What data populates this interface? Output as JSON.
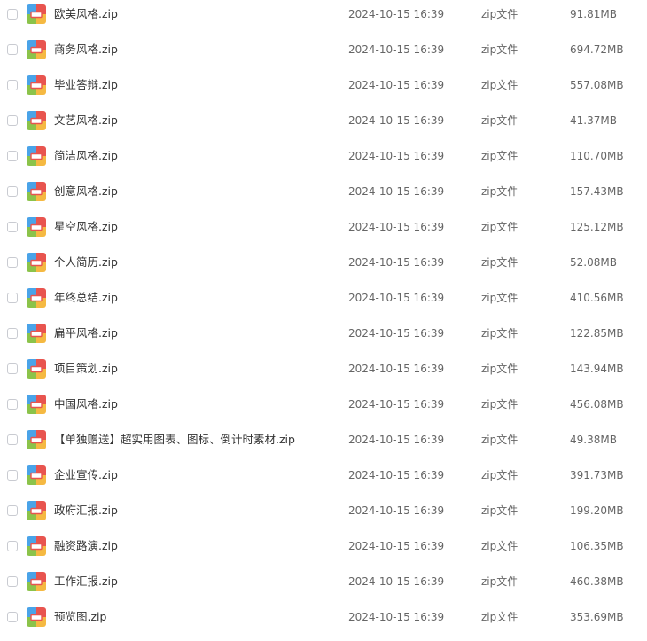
{
  "files": [
    {
      "name": "欧美风格.zip",
      "date": "2024-10-15 16:39",
      "type": "zip文件",
      "size": "91.81MB",
      "icon": "zip-icon"
    },
    {
      "name": "商务风格.zip",
      "date": "2024-10-15 16:39",
      "type": "zip文件",
      "size": "694.72MB",
      "icon": "zip-icon"
    },
    {
      "name": "毕业答辩.zip",
      "date": "2024-10-15 16:39",
      "type": "zip文件",
      "size": "557.08MB",
      "icon": "zip-icon"
    },
    {
      "name": "文艺风格.zip",
      "date": "2024-10-15 16:39",
      "type": "zip文件",
      "size": "41.37MB",
      "icon": "zip-icon"
    },
    {
      "name": "简洁风格.zip",
      "date": "2024-10-15 16:39",
      "type": "zip文件",
      "size": "110.70MB",
      "icon": "zip-icon"
    },
    {
      "name": "创意风格.zip",
      "date": "2024-10-15 16:39",
      "type": "zip文件",
      "size": "157.43MB",
      "icon": "zip-icon"
    },
    {
      "name": "星空风格.zip",
      "date": "2024-10-15 16:39",
      "type": "zip文件",
      "size": "125.12MB",
      "icon": "zip-icon"
    },
    {
      "name": "个人简历.zip",
      "date": "2024-10-15 16:39",
      "type": "zip文件",
      "size": "52.08MB",
      "icon": "zip-icon"
    },
    {
      "name": "年终总结.zip",
      "date": "2024-10-15 16:39",
      "type": "zip文件",
      "size": "410.56MB",
      "icon": "zip-icon"
    },
    {
      "name": "扁平风格.zip",
      "date": "2024-10-15 16:39",
      "type": "zip文件",
      "size": "122.85MB",
      "icon": "zip-icon"
    },
    {
      "name": "项目策划.zip",
      "date": "2024-10-15 16:39",
      "type": "zip文件",
      "size": "143.94MB",
      "icon": "zip-icon"
    },
    {
      "name": "中国风格.zip",
      "date": "2024-10-15 16:39",
      "type": "zip文件",
      "size": "456.08MB",
      "icon": "zip-icon"
    },
    {
      "name": "【单独赠送】超实用图表、图标、倒计时素材.zip",
      "date": "2024-10-15 16:39",
      "type": "zip文件",
      "size": "49.38MB",
      "icon": "zip-icon"
    },
    {
      "name": "企业宣传.zip",
      "date": "2024-10-15 16:39",
      "type": "zip文件",
      "size": "391.73MB",
      "icon": "zip-icon"
    },
    {
      "name": "政府汇报.zip",
      "date": "2024-10-15 16:39",
      "type": "zip文件",
      "size": "199.20MB",
      "icon": "zip-icon"
    },
    {
      "name": "融资路演.zip",
      "date": "2024-10-15 16:39",
      "type": "zip文件",
      "size": "106.35MB",
      "icon": "zip-icon"
    },
    {
      "name": "工作汇报.zip",
      "date": "2024-10-15 16:39",
      "type": "zip文件",
      "size": "460.38MB",
      "icon": "zip-icon"
    },
    {
      "name": "预览图.zip",
      "date": "2024-10-15 16:39",
      "type": "zip文件",
      "size": "353.69MB",
      "icon": "zip-icon"
    }
  ],
  "colors": {
    "icon_top_left": "#4aa3e8",
    "icon_top_right": "#e8544f",
    "icon_bottom_left": "#8bc34a",
    "icon_bottom_right": "#f5b942",
    "icon_tag": "#e8544f"
  }
}
